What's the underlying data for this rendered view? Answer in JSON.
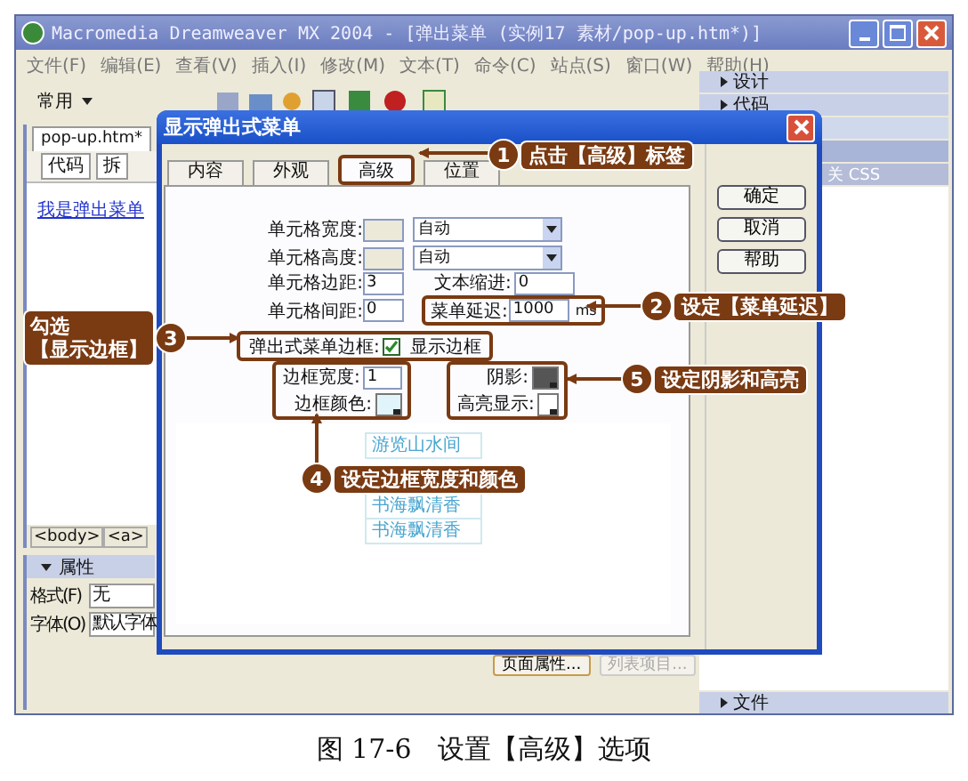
{
  "app_window": {
    "title": "Macromedia Dreamweaver MX 2004 - [弹出菜单 (实例17 素材/pop-up.htm*)]",
    "menu": [
      "文件(F)",
      "编辑(E)",
      "查看(V)",
      "插入(I)",
      "修改(M)",
      "文本(T)",
      "命令(C)",
      "站点(S)",
      "窗口(W)",
      "帮助(H)"
    ],
    "toolbar_category": "常用"
  },
  "document": {
    "tab": "pop-up.htm*",
    "view_buttons": [
      "代码",
      "拆"
    ],
    "link": "我是弹出菜单",
    "tag_selector": [
      "<body>",
      "<a>"
    ]
  },
  "properties": {
    "title": "属性",
    "expanded": true,
    "fields": [
      {
        "label": "格式(F)",
        "value": "无"
      },
      {
        "label": "字体(O)",
        "value": "默认字体"
      }
    ],
    "buttons": [
      {
        "label": "页面属性...",
        "disabled": false
      },
      {
        "label": "列表项目...",
        "disabled": true
      }
    ]
  },
  "panels": [
    {
      "label": "设计",
      "expanded": false
    },
    {
      "label": "代码",
      "expanded": false
    }
  ],
  "css_panel": "关 CSS",
  "files_panel": {
    "label": "文件",
    "expanded": false
  },
  "dialog": {
    "title": "显示弹出式菜单",
    "tabs": [
      {
        "label": "内容",
        "selected": false
      },
      {
        "label": "外观",
        "selected": false
      },
      {
        "label": "高级",
        "selected": true
      },
      {
        "label": "位置",
        "selected": false
      }
    ],
    "buttons": [
      "确定",
      "取消",
      "帮助"
    ],
    "cell_width": {
      "label": "单元格宽度:",
      "value": "自动"
    },
    "cell_height": {
      "label": "单元格高度:",
      "value": "自动"
    },
    "cell_padding": {
      "label": "单元格边距:",
      "value": "3"
    },
    "text_indent": {
      "label": "文本缩进:",
      "value": "0"
    },
    "cell_spacing": {
      "label": "单元格间距:",
      "value": "0"
    },
    "menu_delay": {
      "label": "菜单延迟:",
      "value": "1000",
      "unit": "ms"
    },
    "border": {
      "label": "弹出式菜单边框:",
      "option": "显示边框",
      "checked": true
    },
    "border_width": {
      "label": "边框宽度:",
      "value": "1"
    },
    "border_color": {
      "label": "边框颜色:"
    },
    "shadow": {
      "label": "阴影:"
    },
    "highlight": {
      "label": "高亮显示:"
    },
    "preview_items": [
      "游览山水间",
      "书海飘清香",
      "书海飘清香"
    ]
  },
  "callouts": [
    {
      "number": "1",
      "lines": [
        "点击【高级】标签"
      ]
    },
    {
      "number": "2",
      "lines": [
        "设定【菜单延迟】"
      ]
    },
    {
      "number": "3",
      "lines": [
        "勾选",
        "【显示边框】"
      ]
    },
    {
      "number": "4",
      "lines": [
        "设定边框宽度和颜色"
      ]
    },
    {
      "number": "5",
      "lines": [
        "设定阴影和高亮"
      ]
    }
  ],
  "caption": "图 17-6　设置【高级】选项"
}
